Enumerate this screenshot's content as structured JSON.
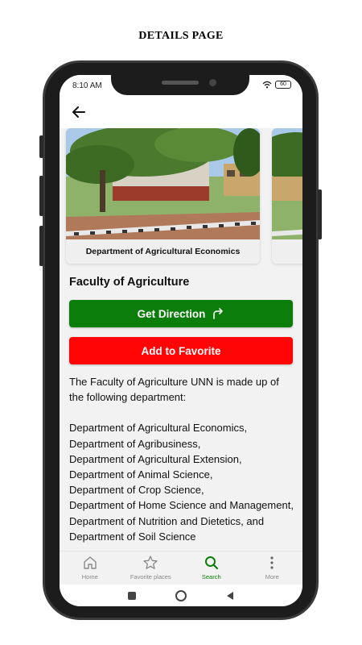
{
  "page_heading": "DETAILS PAGE",
  "status_bar": {
    "time": "8:10 AM",
    "battery": "60"
  },
  "carousel": {
    "cards": [
      {
        "caption": "Department of Agricultural Economics"
      }
    ]
  },
  "faculty_title": "Faculty of Agriculture",
  "buttons": {
    "direction_label": "Get Direction",
    "favorite_label": "Add to Favorite"
  },
  "description": {
    "intro": "The Faculty of Agriculture UNN is made up of the following department:",
    "departments": [
      "Department of Agricultural Economics,",
      "Department of Agribusiness,",
      "Department of Agricultural Extension,",
      "Department of Animal Science,",
      "Department of Crop Science,",
      "Department of Home Science and Management,",
      "Department of Nutrition and Dietetics, and",
      "Department of Soil Science"
    ]
  },
  "bottom_nav": [
    {
      "label": "Home",
      "icon": "home-icon"
    },
    {
      "label": "Favorite places",
      "icon": "star-icon"
    },
    {
      "label": "Search",
      "icon": "search-icon"
    },
    {
      "label": "More",
      "icon": "more-vertical-icon"
    }
  ],
  "colors": {
    "primary_green": "#0b7d0b",
    "favorite_red": "#ff0505",
    "screen_background": "#f2f2f2"
  }
}
